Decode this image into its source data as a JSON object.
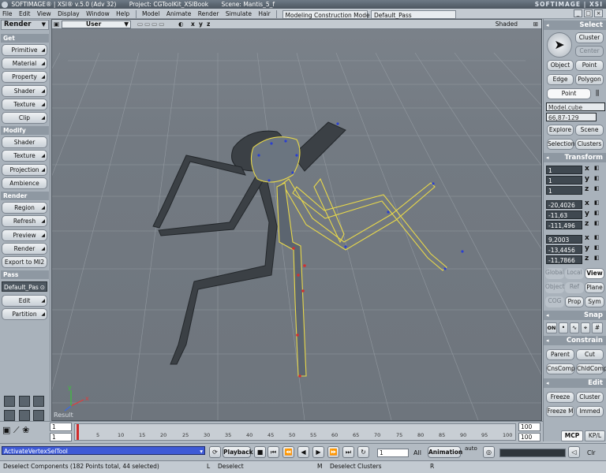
{
  "titlebar": {
    "app": "SOFTIMAGE® | XSI® v.5.0 (Adv 32)",
    "project": "Project: CGToolKit_XSIBook",
    "scene": "Scene: Mantis_5_f",
    "brand": "SOFTIMAGE | XSI"
  },
  "menubar": {
    "items": [
      "File",
      "Edit",
      "View",
      "Display",
      "Window",
      "Help"
    ],
    "modules": [
      "Model",
      "Animate",
      "Render",
      "Simulate",
      "Hair"
    ],
    "mode": "Modeling Construction Mode",
    "pass": "Default_Pass"
  },
  "left": {
    "mode": "Render",
    "sections": [
      "Get",
      "Modify",
      "Render",
      "Pass"
    ],
    "get": [
      "Primitive",
      "Material",
      "Property",
      "Shader",
      "Texture",
      "Clip"
    ],
    "modify": [
      "Shader",
      "Texture",
      "Projection",
      "Ambience"
    ],
    "render": [
      "Region",
      "Refresh",
      "Preview",
      "Render",
      "Export to MI2"
    ],
    "pass_field": "Default_Pas",
    "pass": [
      "Edit",
      "Partition"
    ]
  },
  "viewport": {
    "camera": "User",
    "shading": "Shaded",
    "result": "Result",
    "axes": [
      "x",
      "y",
      "z"
    ]
  },
  "right": {
    "select": "Select",
    "select_btns": [
      "Cluster",
      "Center",
      "Object",
      "Point",
      "Edge",
      "Polygon",
      "Point"
    ],
    "model_field": "Model.cube",
    "range_field": "66,87-129",
    "nav_btns": [
      "Explore",
      "Scene",
      "Selection",
      "Clusters"
    ],
    "transform": "Transform",
    "scale": [
      "1",
      "1",
      "1"
    ],
    "rotate": [
      "-20,4026",
      "-11,63",
      "-111,496"
    ],
    "translate": [
      "9,2003",
      "-13,4456",
      "-11,7866"
    ],
    "axes": [
      "x",
      "y",
      "z"
    ],
    "ref_btns": [
      "Global",
      "Local",
      "View",
      "Object",
      "Ref",
      "Plane",
      "COG",
      "Prop",
      "Sym"
    ],
    "snap": "Snap",
    "snap_on": "ON",
    "constrain": "Constrain",
    "constrain_btns": [
      "Parent",
      "Cut",
      "CnsComp",
      "ChldComp"
    ],
    "edit": "Edit",
    "edit_btns": [
      "Freeze",
      "Cluster",
      "Freeze M",
      "Immed"
    ],
    "mcp_tabs": [
      "MCP",
      "KP/L"
    ]
  },
  "timeline": {
    "start": "1",
    "current": "1",
    "end": "100",
    "end2": "100",
    "ticks": [
      "5",
      "10",
      "15",
      "20",
      "25",
      "30",
      "35",
      "40",
      "45",
      "50",
      "55",
      "60",
      "65",
      "70",
      "75",
      "80",
      "85",
      "90",
      "95",
      "100"
    ]
  },
  "playbar": {
    "command": "ActivateVertexSelTool",
    "playback": "Playback",
    "frame": "1",
    "all": "All",
    "animation": "Animation",
    "auto": "auto",
    "clr": "Clr"
  },
  "status": {
    "left": "Deselect Components (182 Points total, 44 selected)",
    "mid": "Deselect",
    "right": "Deselect Clusters"
  },
  "colors": {
    "selection": "#e8d84a",
    "wire_points": "#2a3fd0",
    "accent_blue": "#3e5ad6"
  }
}
